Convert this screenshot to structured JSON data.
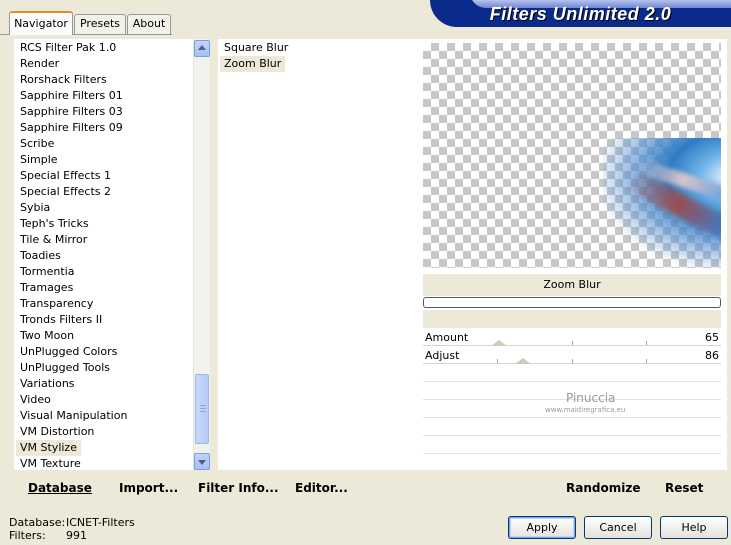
{
  "tabs": [
    {
      "label": "Navigator",
      "active": true
    },
    {
      "label": "Presets",
      "active": false
    },
    {
      "label": "About",
      "active": false
    }
  ],
  "banner": {
    "title": "Filters Unlimited 2.0"
  },
  "categories": [
    "RCS Filter Pak 1.0",
    "Render",
    "Rorshack Filters",
    "Sapphire Filters 01",
    "Sapphire Filters 03",
    "Sapphire Filters 09",
    "Scribe",
    "Simple",
    "Special Effects 1",
    "Special Effects 2",
    "Sybia",
    "Teph's Tricks",
    "Tile & Mirror",
    "Toadies",
    "Tormentia",
    "Tramages",
    "Transparency",
    "Tronds Filters II",
    "Two Moon",
    "UnPlugged Colors",
    "UnPlugged Tools",
    "Variations",
    "Video",
    "Visual Manipulation",
    "VM Distortion",
    "VM Stylize",
    "VM Texture"
  ],
  "selected_category": "VM Stylize",
  "filters": [
    "Square Blur",
    "Zoom Blur"
  ],
  "selected_filter": "Zoom Blur",
  "preview": {
    "filter_name": "Zoom Blur"
  },
  "sliders": [
    {
      "label": "Amount",
      "value": "65",
      "fraction": 0.255
    },
    {
      "label": "Adjust",
      "value": "86",
      "fraction": 0.337
    }
  ],
  "watermark": {
    "name": "Pinuccia",
    "url": "www.maidiregrafica.eu"
  },
  "toolbar": {
    "database": "Database",
    "import": "Import...",
    "filter_info": "Filter Info...",
    "editor": "Editor...",
    "randomize": "Randomize",
    "reset": "Reset"
  },
  "status": {
    "database_label": "Database:",
    "database_value": "ICNET-Filters",
    "filters_label": "Filters:",
    "filters_value": "991"
  },
  "buttons": {
    "apply": "Apply",
    "cancel": "Cancel",
    "help": "Help"
  }
}
